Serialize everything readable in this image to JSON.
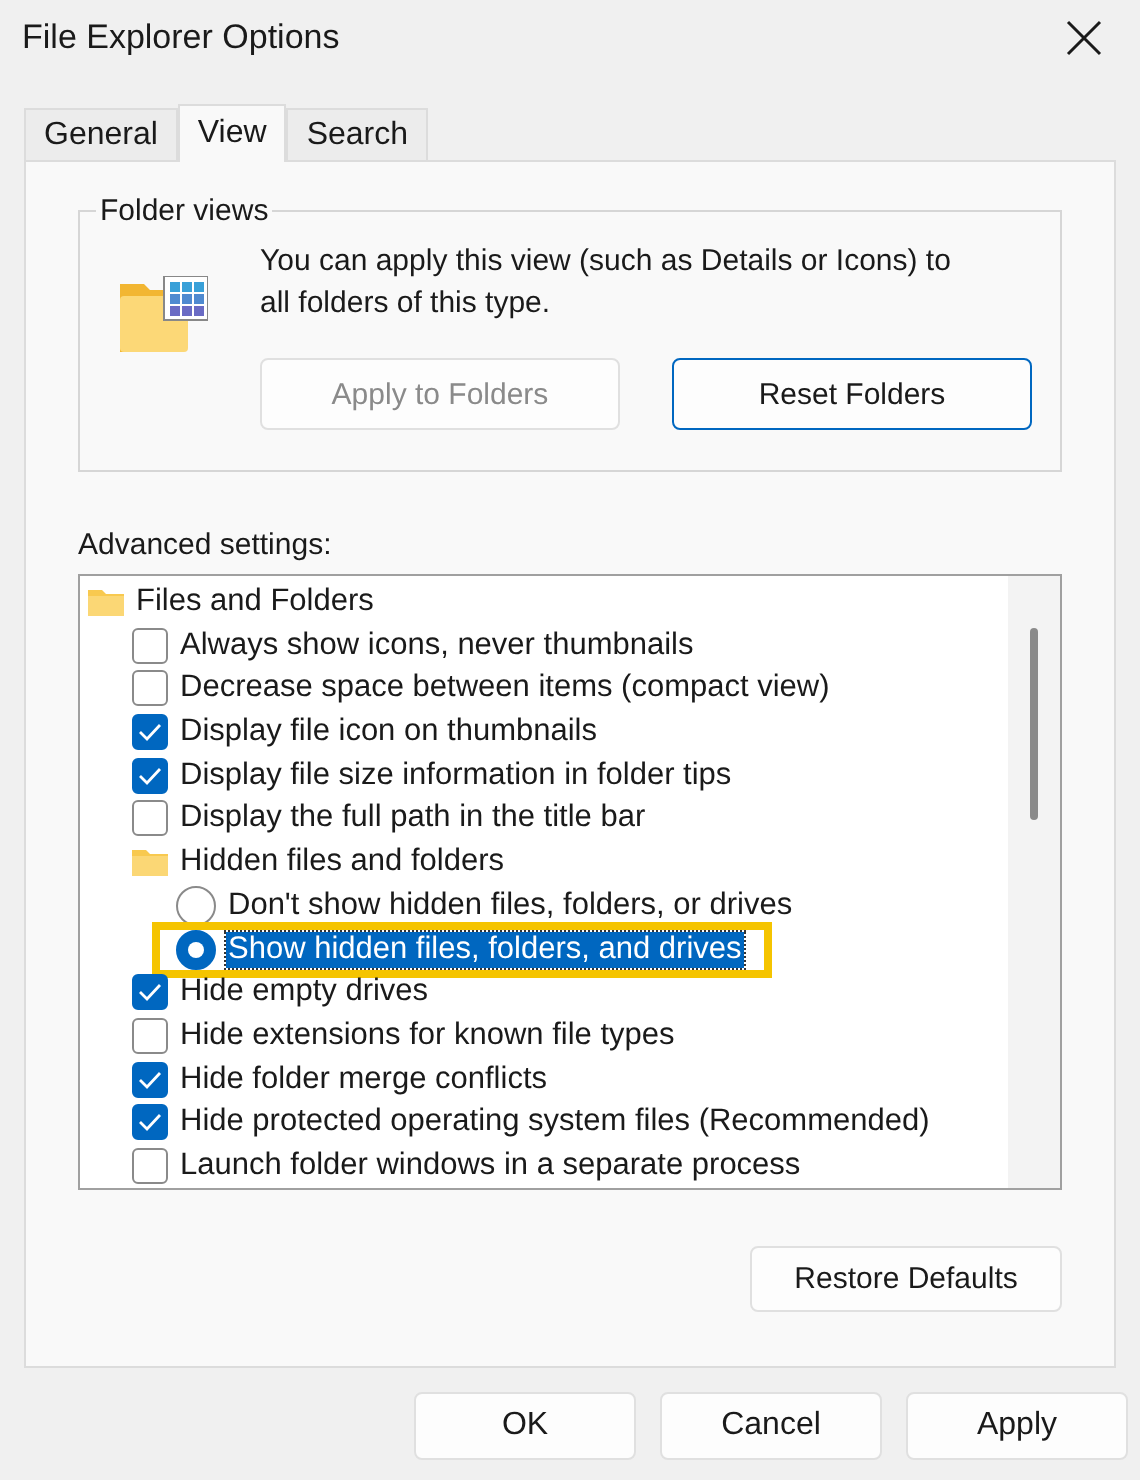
{
  "window": {
    "title": "File Explorer Options"
  },
  "tabs": [
    {
      "label": "General",
      "selected": false
    },
    {
      "label": "View",
      "selected": true
    },
    {
      "label": "Search",
      "selected": false
    }
  ],
  "folder_views": {
    "title": "Folder views",
    "description": "You can apply this view (such as Details or Icons) to all folders of this type.",
    "buttons": [
      {
        "label": "Apply to Folders",
        "disabled": true
      },
      {
        "label": "Reset Folders",
        "disabled": false
      }
    ]
  },
  "advanced": {
    "label": "Advanced settings:",
    "items": [
      {
        "kind": "folder",
        "label": "Files and Folders",
        "children": [
          {
            "kind": "checkbox",
            "label": "Always show icons, never thumbnails",
            "checked": false
          },
          {
            "kind": "checkbox",
            "label": "Decrease space between items (compact view)",
            "checked": false
          },
          {
            "kind": "checkbox",
            "label": "Display file icon on thumbnails",
            "checked": true
          },
          {
            "kind": "checkbox",
            "label": "Display file size information in folder tips",
            "checked": true
          },
          {
            "kind": "checkbox",
            "label": "Display the full path in the title bar",
            "checked": false
          },
          {
            "kind": "folder",
            "label": "Hidden files and folders",
            "children": [
              {
                "kind": "radio",
                "label": "Don't show hidden files, folders, or drives",
                "selected": false,
                "highlighted": false
              },
              {
                "kind": "radio",
                "label": "Show hidden files, folders, and drives",
                "selected": true,
                "highlighted": true
              }
            ]
          },
          {
            "kind": "checkbox",
            "label": "Hide empty drives",
            "checked": true
          },
          {
            "kind": "checkbox",
            "label": "Hide extensions for known file types",
            "checked": false
          },
          {
            "kind": "checkbox",
            "label": "Hide folder merge conflicts",
            "checked": true
          },
          {
            "kind": "checkbox",
            "label": "Hide protected operating system files (Recommended)",
            "checked": true
          },
          {
            "kind": "checkbox",
            "label": "Launch folder windows in a separate process",
            "checked": false
          }
        ]
      }
    ]
  },
  "restore_button": "Restore Defaults",
  "buttons": [
    "OK",
    "Cancel",
    "Apply"
  ]
}
